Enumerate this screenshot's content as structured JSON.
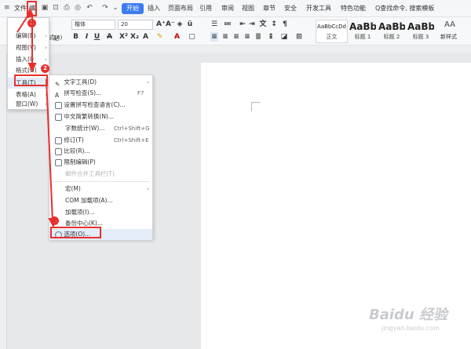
{
  "menubar": {
    "file": "文件",
    "edit_partial": "编",
    "tabs": [
      "开始",
      "插入",
      "页面布局",
      "引用",
      "审阅",
      "视图",
      "章节",
      "安全",
      "开发工具",
      "特色功能"
    ],
    "search": "Q查找命令, 搜索模板"
  },
  "ribbon": {
    "font_name": "楷体",
    "font_size": "20",
    "style_names": [
      "正文",
      "标题 1",
      "标题 2",
      "标题 3"
    ],
    "style_samples": [
      "AaBbCcDd",
      "AaBb",
      "AaBb(",
      "AaBbC("
    ],
    "new_style": "新样式",
    "new_style_icon": "AA",
    "left_labels": [
      "贴",
      "式刷"
    ],
    "mid_label": "式(R)"
  },
  "left_menu": {
    "items": [
      "编辑(E)",
      "视图(V)",
      "插入(I)",
      "格式(O)",
      "工具(T)",
      "表格(A)",
      "窗口(W)"
    ]
  },
  "tools_menu": {
    "items": [
      {
        "label": "文字工具(D)",
        "shortcut": "",
        "arrow": "›"
      },
      {
        "label": "拼写检查(S)...",
        "shortcut": "F7",
        "arrow": ""
      },
      {
        "label": "设置拼写检查语言(C)...",
        "shortcut": "",
        "arrow": ""
      },
      {
        "label": "中文简繁转换(N)...",
        "shortcut": "",
        "arrow": ""
      },
      {
        "label": "字数统计(W)...",
        "shortcut": "Ctrl+Shift+G",
        "arrow": ""
      },
      {
        "label": "修订(T)",
        "shortcut": "Ctrl+Shift+E",
        "arrow": ""
      },
      {
        "label": "比较(R)...",
        "shortcut": "",
        "arrow": ""
      },
      {
        "label": "限制编辑(P)",
        "shortcut": "",
        "arrow": ""
      },
      {
        "label": "邮件合并工具栏(T)",
        "shortcut": "",
        "arrow": ""
      },
      {
        "label": "宏(M)",
        "shortcut": "",
        "arrow": "›"
      },
      {
        "label": "COM 加载项(A)...",
        "shortcut": "",
        "arrow": ""
      },
      {
        "label": "加载项(I)...",
        "shortcut": "",
        "arrow": ""
      },
      {
        "label": "备份中心(K)...",
        "shortcut": "",
        "arrow": ""
      },
      {
        "label": "选项(O)...",
        "shortcut": "",
        "arrow": ""
      }
    ]
  },
  "annotations": {
    "badge1": "1",
    "badge2": "2",
    "badge3": "3"
  },
  "watermark": {
    "text": "Baidu 经验",
    "url": "jingyan.baidu.com"
  },
  "colors": {
    "accent": "#3b7cf0",
    "annotation_red": "#e8302f"
  }
}
